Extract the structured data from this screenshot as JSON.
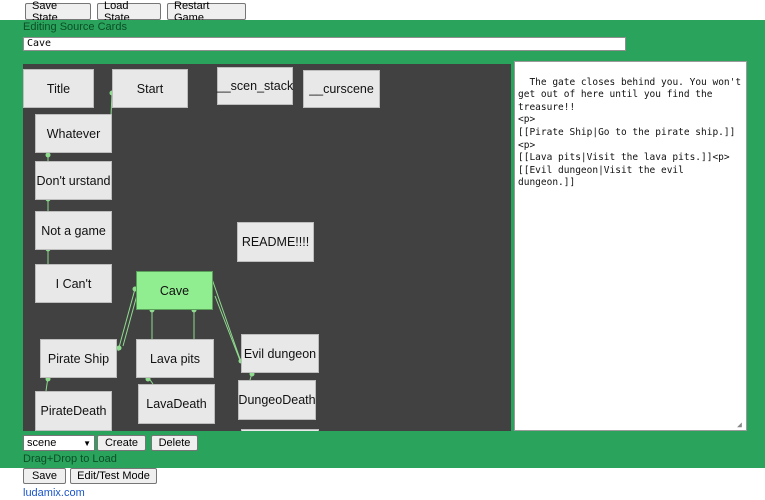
{
  "topbar": {
    "save_state": "Save State",
    "load_state": "Load State",
    "restart_game": "Restart Game"
  },
  "editor_header": "Editing Source Cards",
  "card_title_value": "Cave",
  "cards": {
    "title": "Title",
    "start": "Start",
    "scen_stack": "__scen_stack",
    "curscene": "__curscene",
    "whatever": "Whatever",
    "dont_urstand": "Don't urstand",
    "not_a_game": "Not a game",
    "i_cant": "I Can't",
    "readme": "README!!!!",
    "cave": "Cave",
    "pirate_ship": "Pirate Ship",
    "lava_pits": "Lava pits",
    "evil_dungeon": "Evil dungeon",
    "pirate_death": "PirateDeath",
    "lava_death": "LavaDeath",
    "dungeo_death": "DungeoDeath"
  },
  "source_text": "The gate closes behind you. You won't get out of here until you find the treasure!!\n<p>\n[[Pirate Ship|Go to the pirate ship.]]<p>\n[[Lava pits|Visit the lava pits.]]<p>\n[[Evil dungeon|Visit the evil dungeon.]]",
  "controls": {
    "type_select_value": "scene",
    "create": "Create",
    "delete": "Delete",
    "drag_drop_hint": "Drag+Drop to Load",
    "save": "Save",
    "edit_test_mode": "Edit/Test Mode"
  },
  "footer_link": "ludamix.com",
  "colors": {
    "panel_green": "#2aa35c",
    "canvas_bg": "#414141",
    "active_card": "#90ee90",
    "link_line": "#8fdc8f"
  }
}
